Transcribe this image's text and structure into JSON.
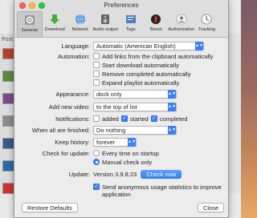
{
  "window": {
    "title": "Preferences"
  },
  "background": {
    "left_label": "Post",
    "left_label2": "Pos"
  },
  "toolbar": [
    {
      "label": "General",
      "icon": "gear-icon"
    },
    {
      "label": "Download",
      "icon": "download-arrow-icon"
    },
    {
      "label": "Network",
      "icon": "globe-icon"
    },
    {
      "label": "Audio output",
      "icon": "speaker-icon"
    },
    {
      "label": "Tags",
      "icon": "tags-icon"
    },
    {
      "label": "Boost",
      "icon": "boost-icon"
    },
    {
      "label": "Authorization",
      "icon": "authorization-icon"
    },
    {
      "label": "Tracking",
      "icon": "tracking-icon"
    }
  ],
  "general": {
    "language_label": "Language:",
    "language_value": "Automatic (American English)",
    "automation_label": "Automation:",
    "automation_options": [
      {
        "label": "Add links from the clipboard automatically",
        "checked": false
      },
      {
        "label": "Start download automatically",
        "checked": false
      },
      {
        "label": "Remove completed automatically",
        "checked": false
      },
      {
        "label": "Expand playlist automatically",
        "checked": false
      }
    ],
    "appearance_label": "Appearance:",
    "appearance_value": "dock only",
    "add_new_video_label": "Add new video:",
    "add_new_video_value": "to the top of list",
    "notifications_label": "Notifications:",
    "notifications": [
      {
        "label": "added",
        "checked": false
      },
      {
        "label": "started",
        "checked": true
      },
      {
        "label": "completed",
        "checked": true
      }
    ],
    "when_finished_label": "When all are finished:",
    "when_finished_value": "Do nothing",
    "keep_history_label": "Keep history:",
    "keep_history_value": "forever",
    "check_update_label": "Check for update:",
    "update_options": [
      {
        "label": "Every time on startup",
        "selected": false
      },
      {
        "label": "Manual check only",
        "selected": true
      }
    ],
    "update_label": "Update:",
    "version_text": "Version 3.9.8.23",
    "check_now": "Check now",
    "anon_stats_line1": "Send anonymous usage statistics to improve",
    "anon_stats_line2": "application",
    "anon_stats_checked": true
  },
  "footer": {
    "restore_defaults": "Restore Defaults",
    "close": "Close"
  },
  "colors": {
    "accent": "#3b82f7"
  }
}
